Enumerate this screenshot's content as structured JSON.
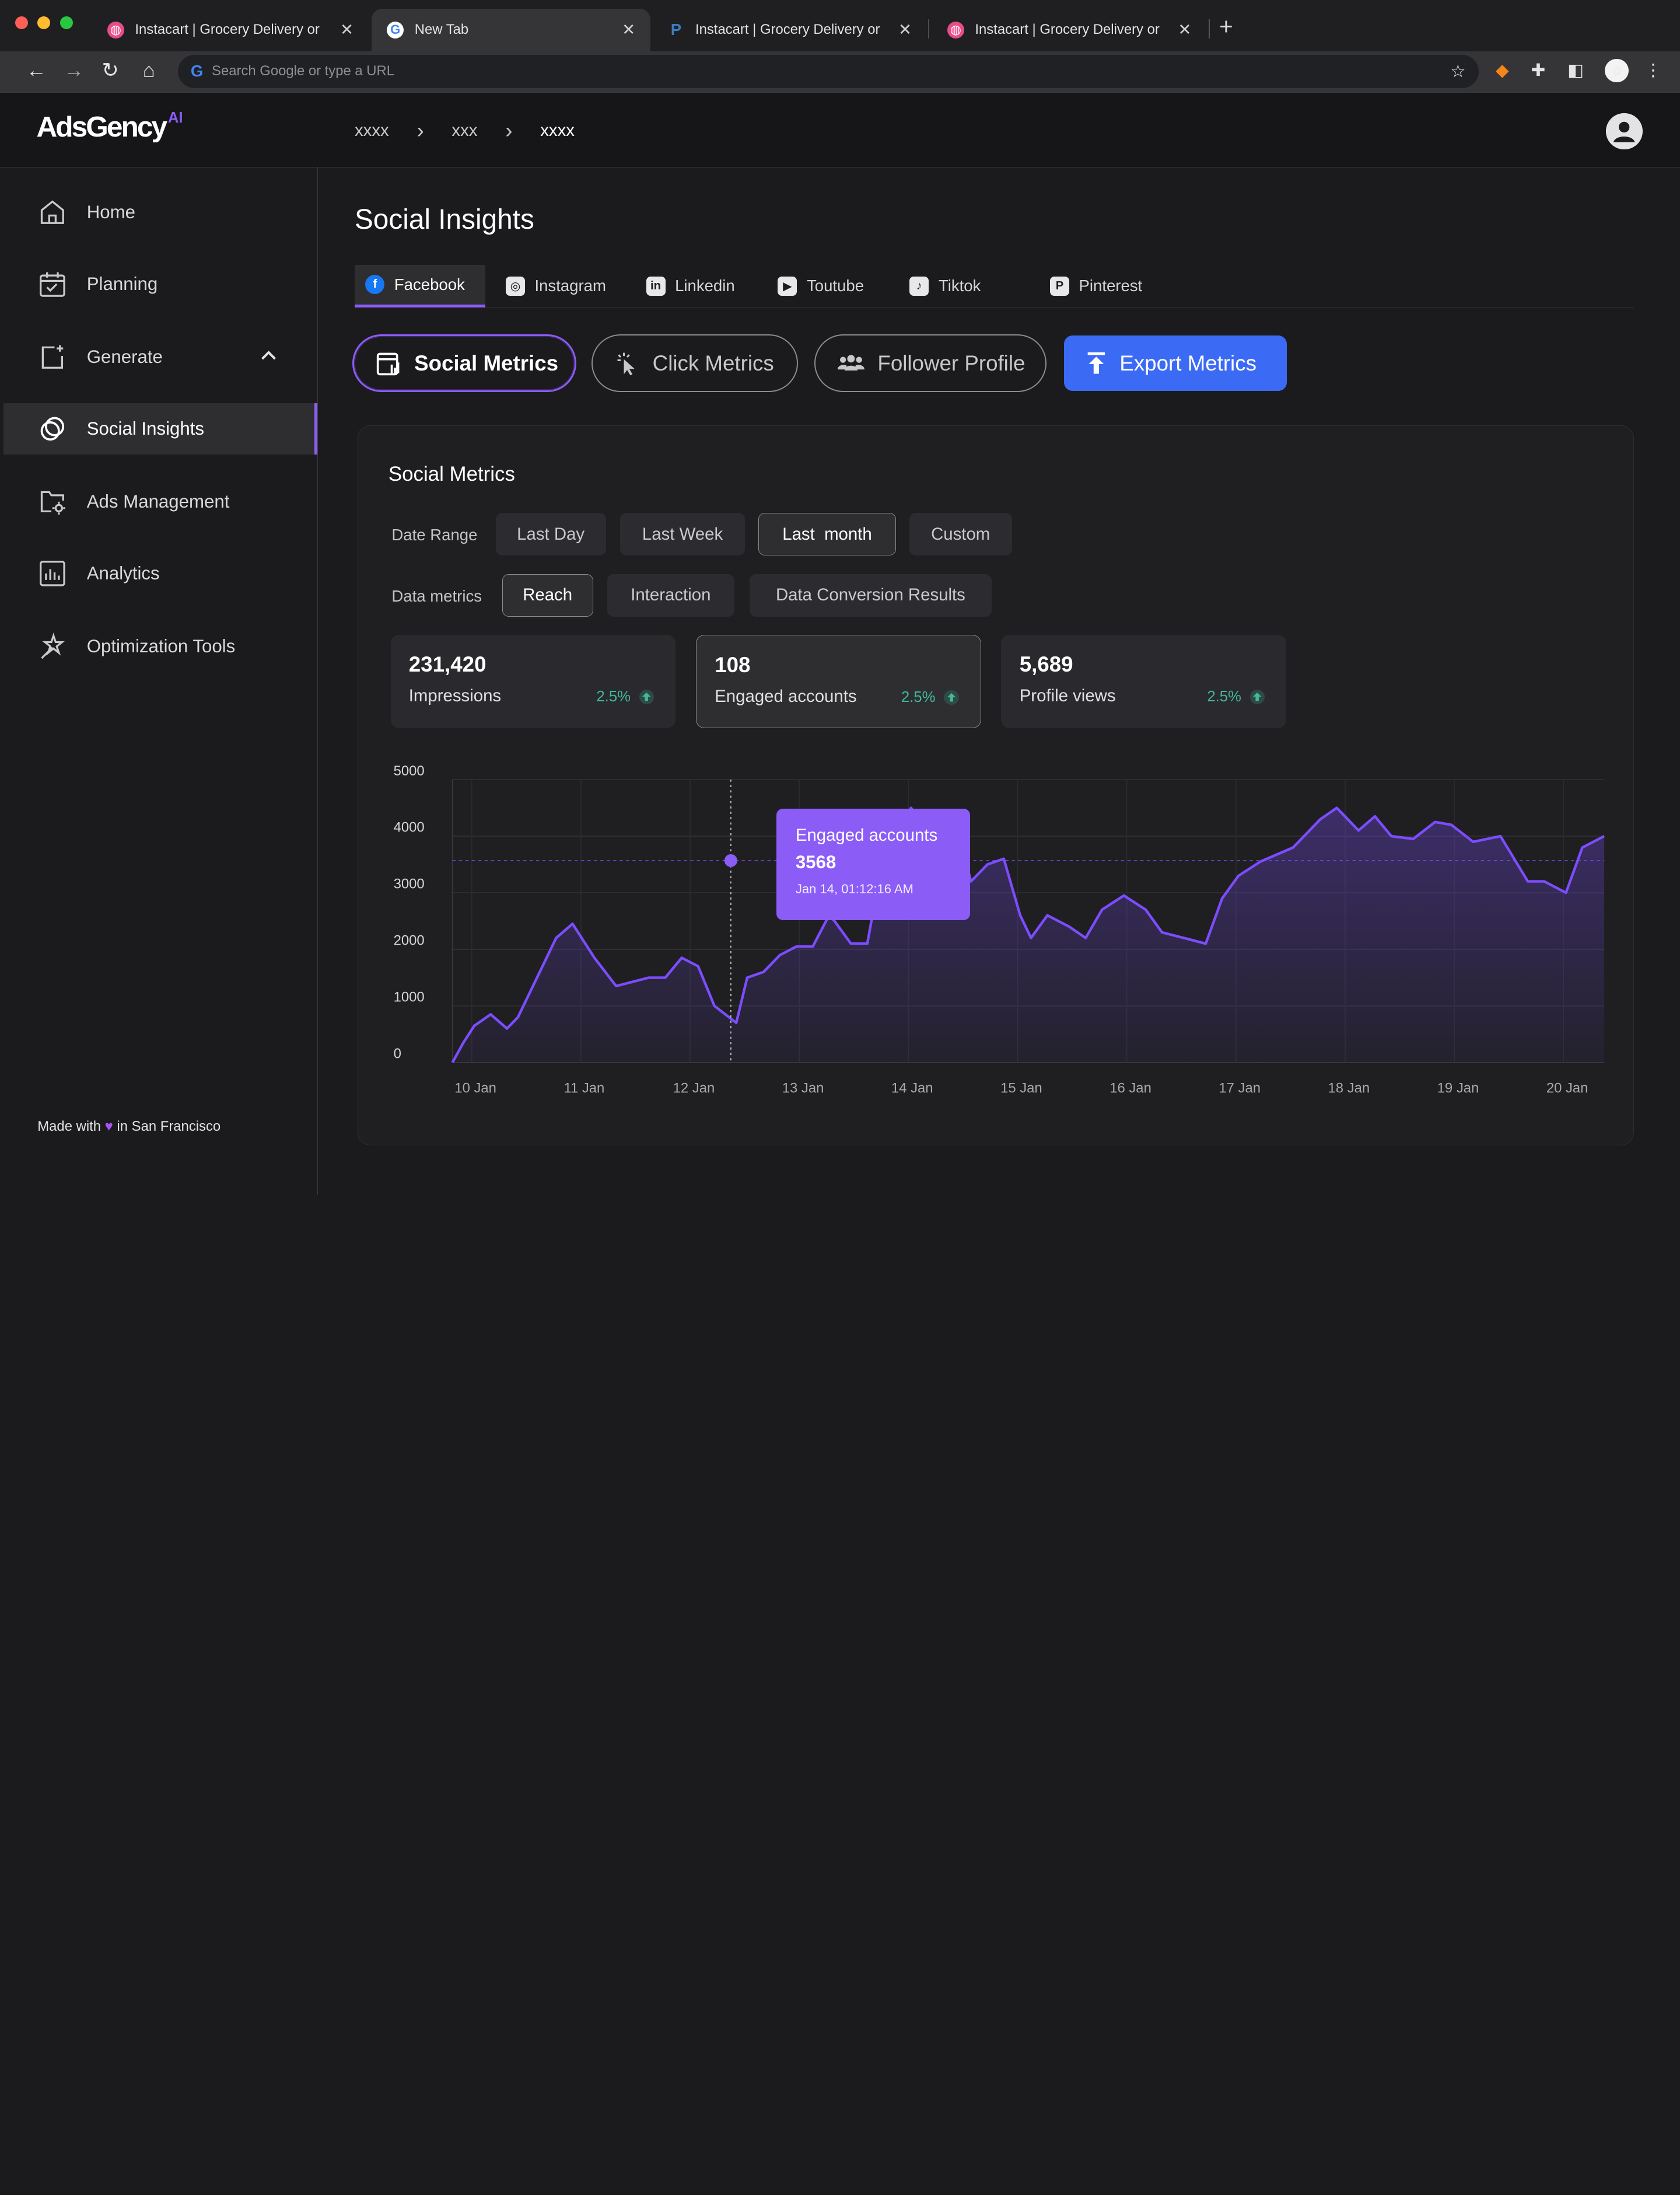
{
  "browser": {
    "tabs": [
      {
        "title": "Instacart | Grocery Delivery or",
        "favicon": "dribbble-icon",
        "color": "#ea4c89"
      },
      {
        "title": "New Tab",
        "favicon": "google-icon",
        "color": "#4285f4"
      },
      {
        "title": "Instacart | Grocery Delivery or",
        "favicon": "paypal-icon",
        "color": "#1f3ba3"
      },
      {
        "title": "Instacart | Grocery Delivery or",
        "favicon": "dribbble-icon",
        "color": "#ea4c89"
      }
    ],
    "address_placeholder": "Search Google or type a URL"
  },
  "header": {
    "logo": "AdsGency",
    "logo_suffix": "AI",
    "breadcrumbs": [
      "xxxx",
      "xxx",
      "xxxx"
    ]
  },
  "sidebar": {
    "items": [
      {
        "label": "Home",
        "icon": "home-icon"
      },
      {
        "label": "Planning",
        "icon": "calendar-icon"
      },
      {
        "label": "Generate",
        "icon": "generate-icon"
      },
      {
        "label": "Social Insights",
        "icon": "social-insights-icon"
      },
      {
        "label": "Ads Management",
        "icon": "folder-settings-icon"
      },
      {
        "label": "Analytics",
        "icon": "analytics-icon"
      },
      {
        "label": "Optimization Tools",
        "icon": "magic-wand-icon"
      }
    ],
    "footer": {
      "made_with": "Made with",
      "location": "in San Francisco"
    }
  },
  "main": {
    "title": "Social Insights",
    "platform_tabs": [
      {
        "label": "Facebook",
        "glyph": "f"
      },
      {
        "label": "Instagram",
        "glyph": "◎"
      },
      {
        "label": "Linkedin",
        "glyph": "in"
      },
      {
        "label": "Toutube",
        "glyph": "▶"
      },
      {
        "label": "Tiktok",
        "glyph": "♪"
      },
      {
        "label": "Pinterest",
        "glyph": "P"
      }
    ],
    "view_buttons": {
      "social_metrics": "Social Metrics",
      "click_metrics": "Click Metrics",
      "follower_profile": "Follower Profile",
      "export": "Export Metrics"
    },
    "card": {
      "title": "Social Metrics",
      "date_range_label": "Date Range",
      "date_ranges": [
        "Last Day",
        "Last Week",
        "Last  month",
        "Custom"
      ],
      "data_metrics_label": "Data metrics",
      "data_metrics": [
        "Reach",
        "Interaction",
        "Data Conversion Results"
      ],
      "stats": [
        {
          "value": "231,420",
          "label": "Impressions",
          "change": "2.5%"
        },
        {
          "value": "108",
          "label": "Engaged accounts",
          "change": "2.5%"
        },
        {
          "value": "5,689",
          "label": "Profile views",
          "change": "2.5%"
        }
      ],
      "tooltip": {
        "title": "Engaged accounts",
        "value": "3568",
        "time": "Jan 14, 01:12:16 AM"
      }
    }
  },
  "colors": {
    "accent": "#8b5cf6",
    "primary_button": "#3b6af5",
    "positive": "#3fb99a"
  },
  "chart_data": {
    "type": "area",
    "series": [
      {
        "name": "Engaged accounts",
        "x": [
          10.0,
          10.1,
          10.2,
          10.35,
          10.5,
          10.6,
          10.8,
          10.95,
          11.1,
          11.3,
          11.5,
          11.8,
          11.95,
          12.1,
          12.25,
          12.4,
          12.6,
          12.7,
          12.85,
          13.0,
          13.15,
          13.3,
          13.45,
          13.5,
          13.65,
          13.8,
          13.95,
          14.2,
          14.35,
          14.5,
          14.6,
          14.75,
          14.9,
          15.05,
          15.2,
          15.3,
          15.45,
          15.65,
          15.8,
          15.95,
          16.15,
          16.35,
          16.5,
          16.7,
          16.9,
          17.05,
          17.2,
          17.4,
          17.7,
          17.95,
          18.1,
          18.3,
          18.45,
          18.6,
          18.8,
          19.0,
          19.15,
          19.35,
          19.6,
          19.85,
          20.0,
          20.2,
          20.35,
          20.55
        ],
        "values": [
          0,
          350,
          650,
          850,
          600,
          800,
          1600,
          2200,
          2450,
          1850,
          1350,
          1500,
          1500,
          1850,
          1700,
          1000,
          700,
          1500,
          1600,
          1900,
          2050,
          2050,
          2600,
          2500,
          2100,
          2100,
          3700,
          4500,
          4100,
          3900,
          4300,
          3200,
          3500,
          3600,
          2600,
          2200,
          2600,
          2400,
          2200,
          2700,
          2950,
          2700,
          2300,
          2200,
          2100,
          2900,
          3300,
          3550,
          3800,
          4300,
          4500,
          4100,
          4350,
          4000,
          3950,
          4250,
          4200,
          3900,
          4000,
          3200,
          3200,
          3000,
          3800,
          4000
        ]
      }
    ],
    "x_tick_labels": [
      "10 Jan",
      "11 Jan",
      "12 Jan",
      "13 Jan",
      "14 Jan",
      "15 Jan",
      "16 Jan",
      "17 Jan",
      "18 Jan",
      "19 Jan",
      "20 Jan"
    ],
    "y_ticks": [
      0,
      1000,
      2000,
      3000,
      4000,
      5000
    ],
    "ylim": [
      0,
      5000
    ],
    "xlim": [
      10.0,
      20.55
    ],
    "grid": true,
    "crosshair": {
      "x": 12.55,
      "value": 3568
    },
    "line_color": "#7c4dff"
  }
}
